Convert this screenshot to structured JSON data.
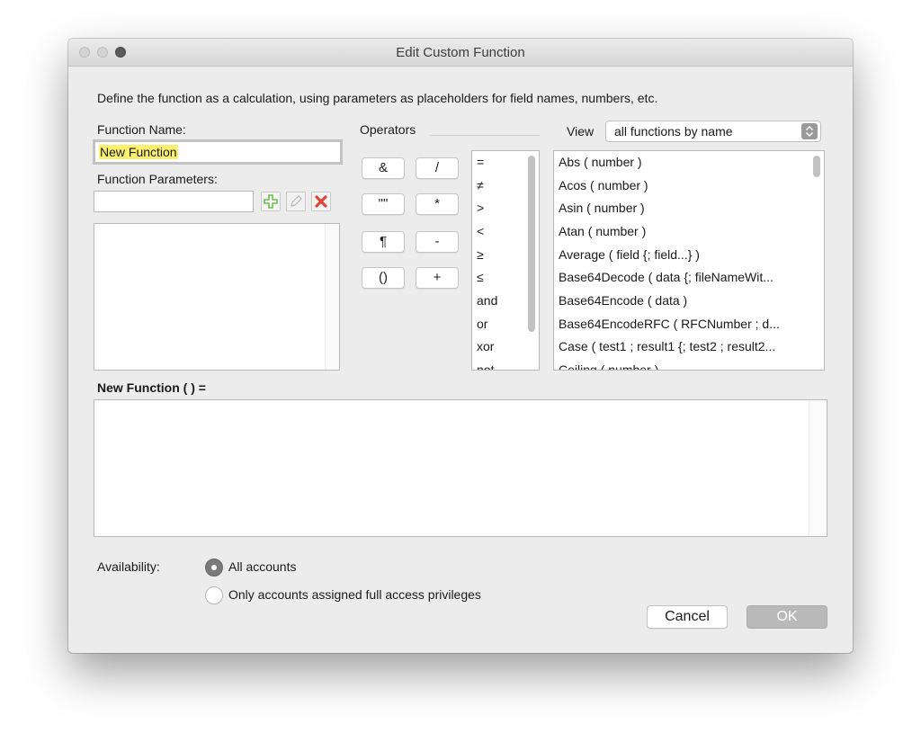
{
  "window": {
    "title": "Edit Custom Function"
  },
  "instructions": "Define the function as a calculation, using parameters as placeholders for field names, numbers, etc.",
  "function_name": {
    "label": "Function Name:",
    "value": "New Function"
  },
  "function_parameters": {
    "label": "Function Parameters:",
    "value": "",
    "items": []
  },
  "operators": {
    "label": "Operators",
    "buttons": [
      "&",
      "/",
      "\"\"",
      "*",
      "¶",
      "-",
      "()",
      "+"
    ],
    "list": [
      "=",
      "≠",
      ">",
      "<",
      "≥",
      "≤",
      "and",
      "or",
      "xor",
      "not"
    ]
  },
  "view": {
    "label": "View",
    "selected": "all functions by name",
    "functions": [
      "Abs ( number )",
      "Acos ( number )",
      "Asin ( number )",
      "Atan ( number )",
      "Average ( field {; field...} )",
      "Base64Decode ( data {; fileNameWit...",
      "Base64Encode ( data )",
      "Base64EncodeRFC ( RFCNumber ; d...",
      "Case ( test1 ; result1 {; test2 ; result2...",
      "Ceiling ( number )"
    ]
  },
  "formula": {
    "heading": "New Function (  ) =",
    "value": ""
  },
  "availability": {
    "label": "Availability:",
    "options": [
      "All accounts",
      "Only accounts assigned full access privileges"
    ],
    "selected_index": 0
  },
  "buttons": {
    "cancel": "Cancel",
    "ok": "OK"
  },
  "colors": {
    "highlight": "#fbef6f",
    "add_icon": "#6cbf4a",
    "delete_icon": "#e0453a"
  }
}
